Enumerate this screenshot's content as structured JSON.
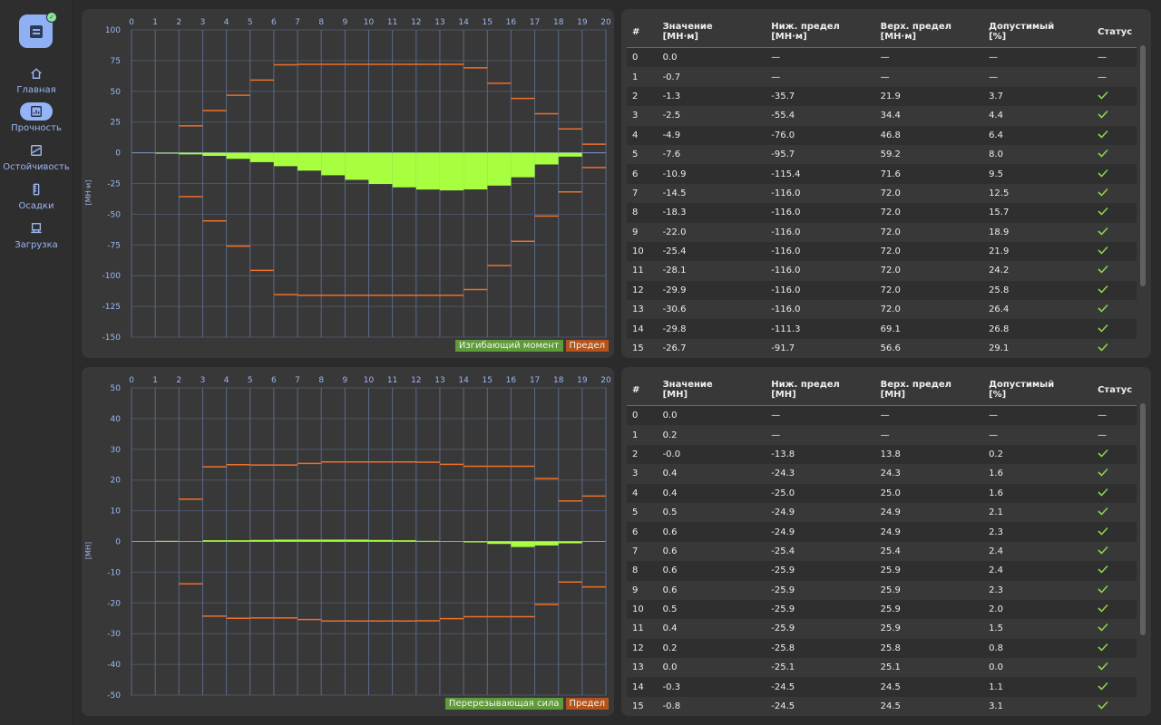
{
  "sidebar": {
    "items": [
      {
        "label": "Главная",
        "icon": "home-icon"
      },
      {
        "label": "Прочность",
        "icon": "strength-chart-icon",
        "active": true
      },
      {
        "label": "Остойчивость",
        "icon": "stability-icon"
      },
      {
        "label": "Осадки",
        "icon": "draft-ruler-icon"
      },
      {
        "label": "Загрузка",
        "icon": "cargo-icon"
      }
    ]
  },
  "colors": {
    "bar_fill": "#a7ff40",
    "limit_line": "#ef6f2a",
    "grid": "#5a6a8a",
    "axis_text": "#9ab7f2"
  },
  "chart_data": [
    {
      "type": "bar",
      "ylabel": "[МН·м]",
      "x": [
        0,
        1,
        2,
        3,
        4,
        5,
        6,
        7,
        8,
        9,
        10,
        11,
        12,
        13,
        14,
        15,
        16,
        17,
        18,
        19,
        20
      ],
      "ylim": [
        -150,
        100
      ],
      "yticks": [
        100,
        75,
        50,
        25,
        0,
        -25,
        -50,
        -75,
        -100,
        -125,
        -150
      ],
      "series": [
        {
          "name": "Изгибающий момент",
          "values": [
            0.0,
            -0.7,
            -1.3,
            -2.5,
            -4.9,
            -7.6,
            -10.9,
            -14.5,
            -18.3,
            -22.0,
            -25.4,
            -28.1,
            -29.9,
            -30.6,
            -29.8,
            -26.7,
            -19.9,
            -9.5,
            -3.1,
            0.0
          ]
        },
        {
          "name": "Предел",
          "upper": [
            null,
            null,
            21.9,
            34.4,
            46.8,
            59.2,
            71.6,
            72.0,
            72.0,
            72.0,
            72.0,
            72.0,
            72.0,
            72.0,
            69.1,
            56.6,
            44.2,
            31.8,
            19.4,
            7.0
          ],
          "lower": [
            null,
            null,
            -35.7,
            -55.4,
            -76.0,
            -95.7,
            -115.4,
            -116.0,
            -116.0,
            -116.0,
            -116.0,
            -116.0,
            -116.0,
            -116.0,
            -111.3,
            -91.7,
            -72.0,
            -51.5,
            -31.8,
            -12.0
          ]
        }
      ]
    },
    {
      "type": "bar",
      "ylabel": "[МН]",
      "x": [
        0,
        1,
        2,
        3,
        4,
        5,
        6,
        7,
        8,
        9,
        10,
        11,
        12,
        13,
        14,
        15,
        16,
        17,
        18,
        19,
        20
      ],
      "ylim": [
        -50,
        50
      ],
      "yticks": [
        50,
        40,
        30,
        20,
        10,
        0,
        -10,
        -20,
        -30,
        -40,
        -50
      ],
      "series": [
        {
          "name": "Перерезывающая сила",
          "values": [
            0.0,
            0.2,
            0.0,
            0.4,
            0.4,
            0.5,
            0.6,
            0.6,
            0.6,
            0.6,
            0.5,
            0.4,
            0.2,
            0.0,
            -0.3,
            -0.8,
            -1.8,
            -1.3,
            -0.6,
            0.0
          ]
        },
        {
          "name": "Предел",
          "upper": [
            null,
            null,
            13.8,
            24.3,
            25.0,
            24.9,
            24.9,
            25.4,
            25.9,
            25.9,
            25.9,
            25.9,
            25.8,
            25.1,
            24.5,
            24.5,
            24.5,
            20.5,
            13.2,
            14.8
          ],
          "lower": [
            null,
            null,
            -13.8,
            -24.3,
            -25.0,
            -24.9,
            -24.9,
            -25.4,
            -25.9,
            -25.9,
            -25.9,
            -25.9,
            -25.8,
            -25.1,
            -24.5,
            -24.5,
            -24.5,
            -20.5,
            -13.2,
            -14.8
          ]
        }
      ]
    }
  ],
  "table1": {
    "headers": [
      "#",
      "Значение\n[МН·м]",
      "Ниж. предел\n[МН·м]",
      "Верх. предел\n[МН·м]",
      "Допустимый\n[%]",
      "Статус"
    ],
    "rows": [
      [
        "0",
        "0.0",
        "—",
        "—",
        "—",
        "—"
      ],
      [
        "1",
        "-0.7",
        "—",
        "—",
        "—",
        "—"
      ],
      [
        "2",
        "-1.3",
        "-35.7",
        "21.9",
        "3.7",
        "ok"
      ],
      [
        "3",
        "-2.5",
        "-55.4",
        "34.4",
        "4.4",
        "ok"
      ],
      [
        "4",
        "-4.9",
        "-76.0",
        "46.8",
        "6.4",
        "ok"
      ],
      [
        "5",
        "-7.6",
        "-95.7",
        "59.2",
        "8.0",
        "ok"
      ],
      [
        "6",
        "-10.9",
        "-115.4",
        "71.6",
        "9.5",
        "ok"
      ],
      [
        "7",
        "-14.5",
        "-116.0",
        "72.0",
        "12.5",
        "ok"
      ],
      [
        "8",
        "-18.3",
        "-116.0",
        "72.0",
        "15.7",
        "ok"
      ],
      [
        "9",
        "-22.0",
        "-116.0",
        "72.0",
        "18.9",
        "ok"
      ],
      [
        "10",
        "-25.4",
        "-116.0",
        "72.0",
        "21.9",
        "ok"
      ],
      [
        "11",
        "-28.1",
        "-116.0",
        "72.0",
        "24.2",
        "ok"
      ],
      [
        "12",
        "-29.9",
        "-116.0",
        "72.0",
        "25.8",
        "ok"
      ],
      [
        "13",
        "-30.6",
        "-116.0",
        "72.0",
        "26.4",
        "ok"
      ],
      [
        "14",
        "-29.8",
        "-111.3",
        "69.1",
        "26.8",
        "ok"
      ],
      [
        "15",
        "-26.7",
        "-91.7",
        "56.6",
        "29.1",
        "ok"
      ]
    ]
  },
  "table2": {
    "headers": [
      "#",
      "Значение\n[МН]",
      "Ниж. предел\n[МН]",
      "Верх. предел\n[МН]",
      "Допустимый\n[%]",
      "Статус"
    ],
    "rows": [
      [
        "0",
        "0.0",
        "—",
        "—",
        "—",
        "—"
      ],
      [
        "1",
        "0.2",
        "—",
        "—",
        "—",
        "—"
      ],
      [
        "2",
        "-0.0",
        "-13.8",
        "13.8",
        "0.2",
        "ok"
      ],
      [
        "3",
        "0.4",
        "-24.3",
        "24.3",
        "1.6",
        "ok"
      ],
      [
        "4",
        "0.4",
        "-25.0",
        "25.0",
        "1.6",
        "ok"
      ],
      [
        "5",
        "0.5",
        "-24.9",
        "24.9",
        "2.1",
        "ok"
      ],
      [
        "6",
        "0.6",
        "-24.9",
        "24.9",
        "2.3",
        "ok"
      ],
      [
        "7",
        "0.6",
        "-25.4",
        "25.4",
        "2.4",
        "ok"
      ],
      [
        "8",
        "0.6",
        "-25.9",
        "25.9",
        "2.4",
        "ok"
      ],
      [
        "9",
        "0.6",
        "-25.9",
        "25.9",
        "2.3",
        "ok"
      ],
      [
        "10",
        "0.5",
        "-25.9",
        "25.9",
        "2.0",
        "ok"
      ],
      [
        "11",
        "0.4",
        "-25.9",
        "25.9",
        "1.5",
        "ok"
      ],
      [
        "12",
        "0.2",
        "-25.8",
        "25.8",
        "0.8",
        "ok"
      ],
      [
        "13",
        "0.0",
        "-25.1",
        "25.1",
        "0.0",
        "ok"
      ],
      [
        "14",
        "-0.3",
        "-24.5",
        "24.5",
        "1.1",
        "ok"
      ],
      [
        "15",
        "-0.8",
        "-24.5",
        "24.5",
        "3.1",
        "ok"
      ]
    ]
  }
}
